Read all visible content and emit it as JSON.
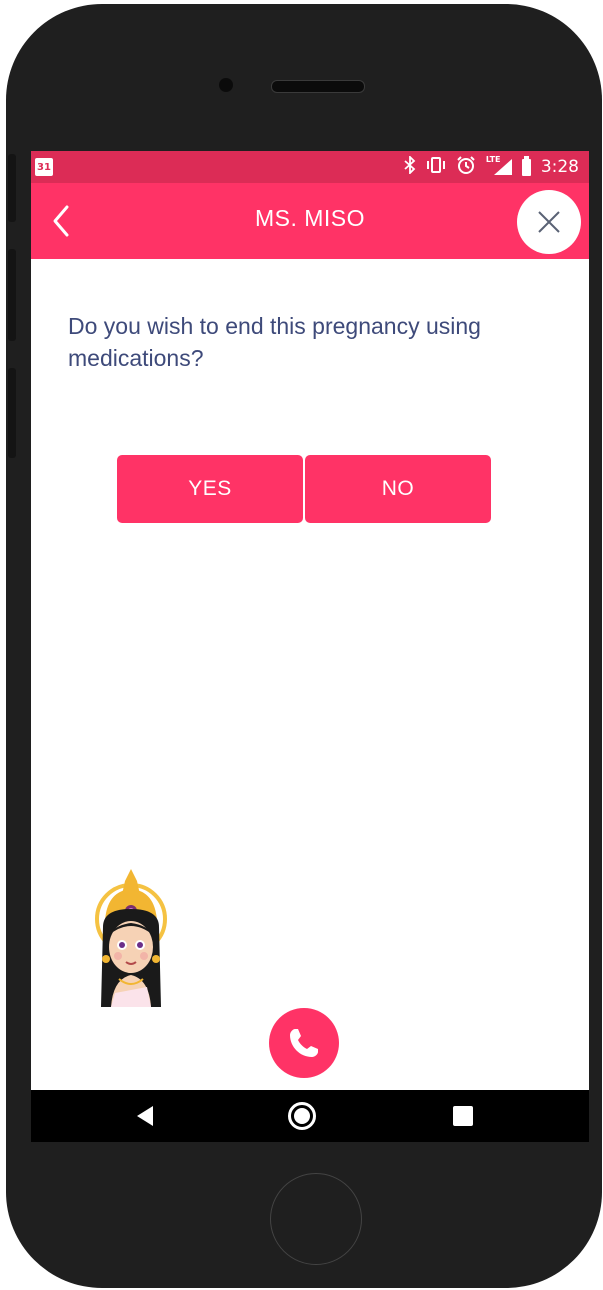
{
  "status_bar": {
    "calendar_day": "31",
    "icons": [
      "bluetooth-icon",
      "vibrate-icon",
      "alarm-icon",
      "lte-signal-icon",
      "battery-icon"
    ],
    "lte_label": "LTE",
    "time": "3:28"
  },
  "app_bar": {
    "back_icon": "chevron-left-icon",
    "title": "MS. MISO",
    "close_icon": "close-icon"
  },
  "question": "Do you wish to end this pregnancy using medications?",
  "answers": {
    "yes_label": "YES",
    "no_label": "NO"
  },
  "avatar_icon": "goddess-avatar-icon",
  "call_icon": "phone-icon",
  "nav_bar": {
    "icons": [
      "back-triangle-icon",
      "home-circle-icon",
      "recent-square-icon"
    ]
  },
  "colors": {
    "primary": "#ff3366",
    "status_bar": "#dc2c56",
    "question_text": "#3e4a7a",
    "phone_frame": "#1f1f1f"
  }
}
